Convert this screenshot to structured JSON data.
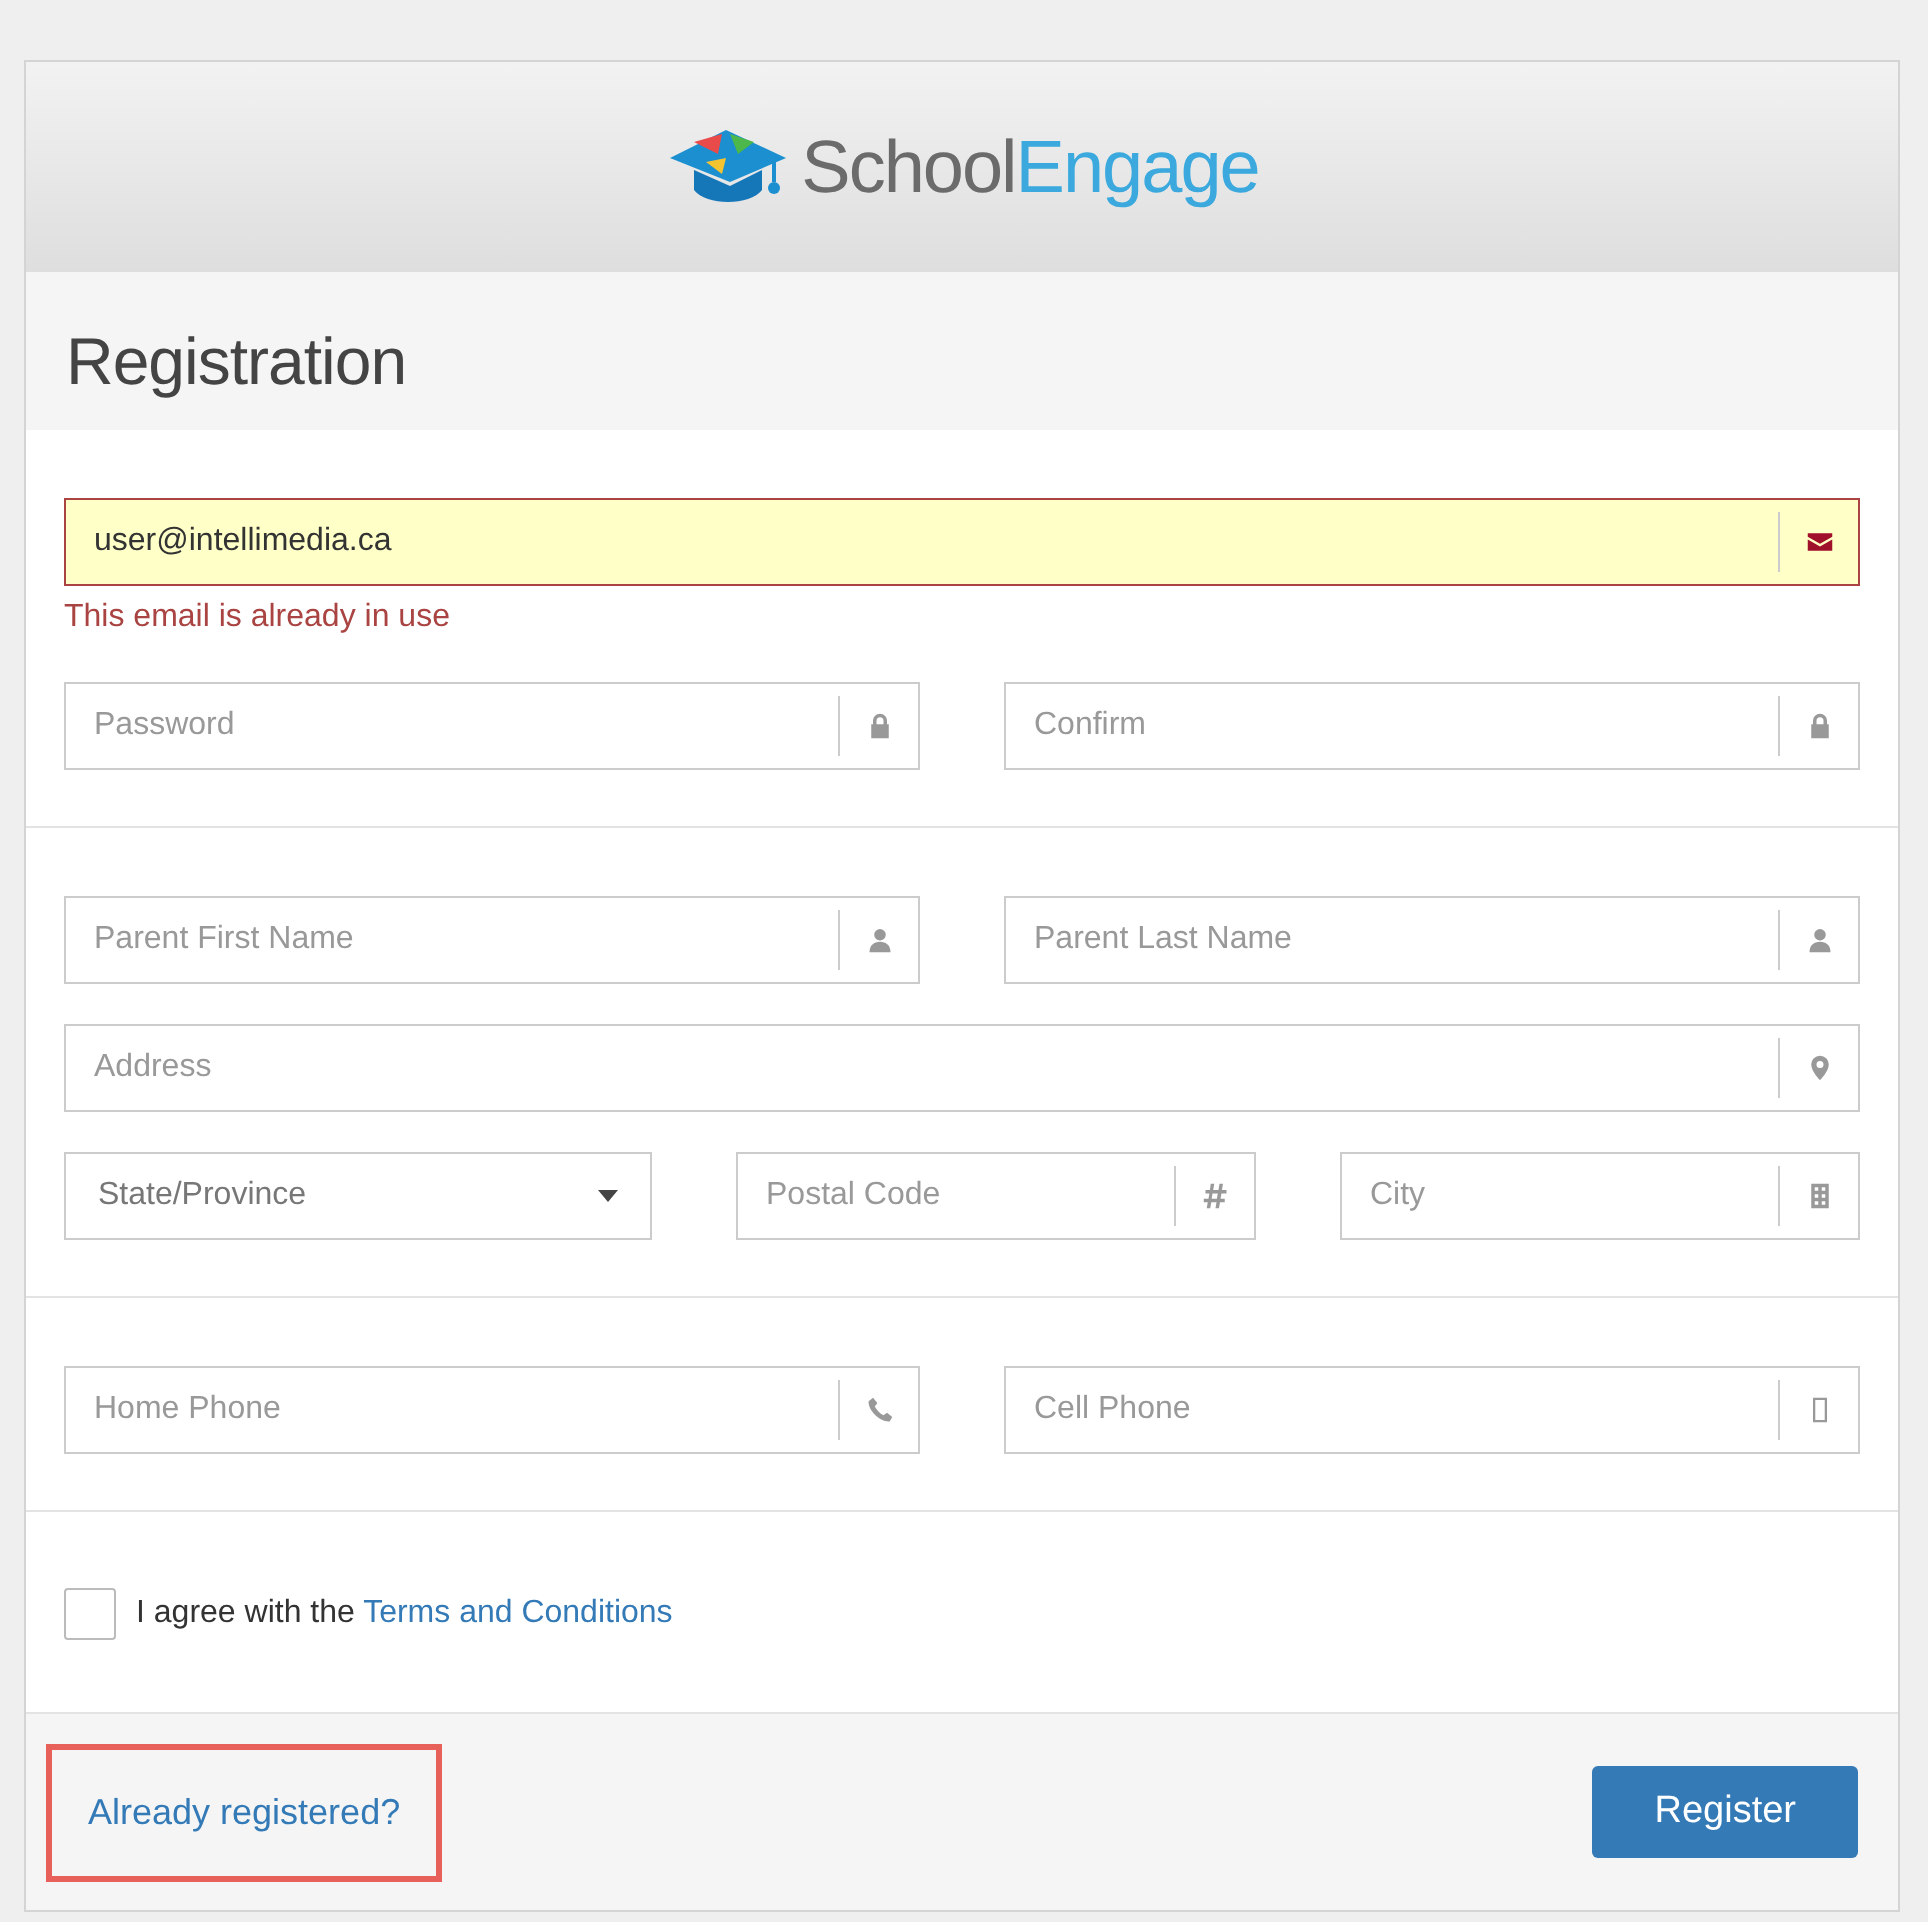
{
  "header": {
    "logo_text_dark": "School",
    "logo_text_light": "Engage"
  },
  "title": "Registration",
  "sections": [
    {
      "rows": [
        [
          {
            "kind": "input",
            "value": "user@intellimedia.ca",
            "invalid": true,
            "error": "This email is already in use"
          }
        ],
        [
          {
            "kind": "input",
            "placeholder": "Password",
            "invalid": false
          },
          {
            "kind": "input",
            "placeholder": "Confirm",
            "invalid": false
          }
        ]
      ]
    },
    {
      "rows": [
        [
          {
            "kind": "input",
            "placeholder": "Parent First Name",
            "invalid": false
          },
          {
            "kind": "input",
            "placeholder": "Parent Last Name",
            "invalid": false
          }
        ],
        [
          {
            "kind": "input",
            "placeholder": "Address",
            "invalid": false
          }
        ],
        [
          {
            "kind": "select",
            "placeholder": "State/Province"
          },
          {
            "kind": "input",
            "placeholder": "Postal Code",
            "invalid": false
          },
          {
            "kind": "input",
            "placeholder": "City",
            "invalid": false
          }
        ]
      ]
    },
    {
      "rows": [
        [
          {
            "kind": "input",
            "placeholder": "Home Phone",
            "invalid": false
          },
          {
            "kind": "input",
            "placeholder": "Cell Phone",
            "invalid": false
          }
        ]
      ]
    }
  ],
  "agreement": {
    "checked": false,
    "text": "I agree with the ",
    "link": "Terms and Conditions"
  },
  "footer": {
    "login_link": {
      "text": "Already registered?",
      "highlighted": true
    },
    "button": "Register"
  }
}
